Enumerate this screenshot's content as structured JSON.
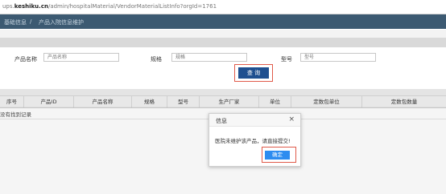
{
  "browser": {
    "url_prefix": "ups.",
    "url_domain": "keshiku.cn",
    "url_path": "/admin/hospitalMaterial/VendorMaterialListInfo?orgId=1761"
  },
  "breadcrumb": {
    "root": "基础信息",
    "separator": "/",
    "current": "产品入院信息维护"
  },
  "search": {
    "product_name_label": "产品名称",
    "product_name_placeholder": "产品名称",
    "spec_label": "规格",
    "spec_placeholder": "规格",
    "model_label": "型号",
    "model_placeholder": "型号",
    "query_button": "查 询"
  },
  "table": {
    "columns": [
      "序号",
      "产品ID",
      "产品名称",
      "规格",
      "型号",
      "生产厂家",
      "单位",
      "定数包单位",
      "定数包数量"
    ],
    "empty_text": "没有找到记录"
  },
  "dialog": {
    "title": "信息",
    "close": "×",
    "message": "医院未维护该产品，请直接提交!",
    "ok_button": "确定"
  },
  "colors": {
    "nav_bar": "#3c5a72",
    "query_button": "#1f4f8f",
    "ok_button": "#2d8cf0",
    "highlight_box": "#e05a4a"
  }
}
